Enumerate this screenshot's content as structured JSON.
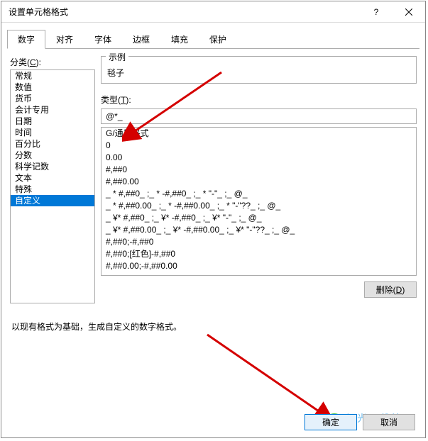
{
  "titlebar": {
    "title": "设置单元格格式"
  },
  "tabs": [
    {
      "label": "数字"
    },
    {
      "label": "对齐"
    },
    {
      "label": "字体"
    },
    {
      "label": "边框"
    },
    {
      "label": "填充"
    },
    {
      "label": "保护"
    }
  ],
  "category": {
    "label": "分类(C):",
    "items": [
      "常规",
      "数值",
      "货币",
      "会计专用",
      "日期",
      "时间",
      "百分比",
      "分数",
      "科学记数",
      "文本",
      "特殊",
      "自定义"
    ],
    "selected": "自定义"
  },
  "sample": {
    "label": "示例",
    "value": "毯子"
  },
  "type": {
    "label": "类型(T):",
    "value": "@*_"
  },
  "formats": [
    "G/通用格式",
    "0",
    "0.00",
    "#,##0",
    "#,##0.00",
    "_ * #,##0_ ;_ * -#,##0_ ;_ * \"-\"_ ;_ @_ ",
    "_ * #,##0.00_ ;_ * -#,##0.00_ ;_ * \"-\"??_ ;_ @_ ",
    "_ ¥* #,##0_ ;_ ¥* -#,##0_ ;_ ¥* \"-\"_ ;_ @_ ",
    "_ ¥* #,##0.00_ ;_ ¥* -#,##0.00_ ;_ ¥* \"-\"??_ ;_ @_ ",
    "#,##0;-#,##0",
    "#,##0;[红色]-#,##0",
    "#,##0.00;-#,##0.00"
  ],
  "buttons": {
    "delete": "删除(D)",
    "ok": "确定",
    "cancel": "取消"
  },
  "help": "以现有格式为基础，生成自定义的数字格式。",
  "watermark": "极光下载站"
}
